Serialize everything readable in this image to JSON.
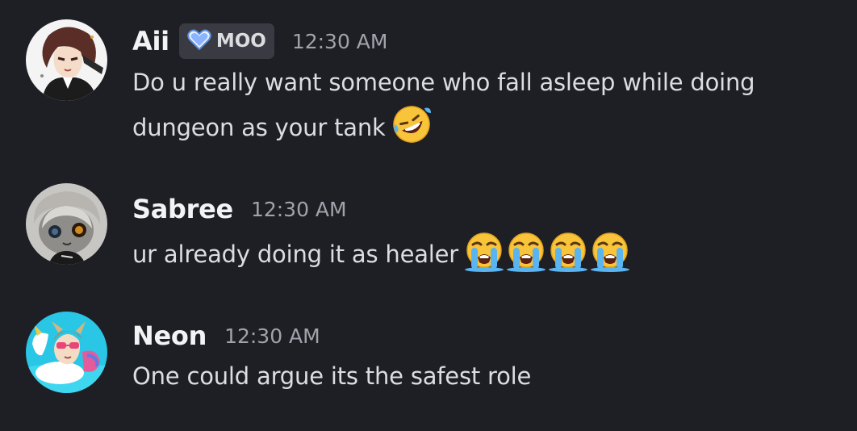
{
  "messages": [
    {
      "username": "Aii",
      "tag": {
        "icon": "heart-icon",
        "label": "MOO"
      },
      "timestamp": "12:30 AM",
      "lines": [
        "Do u really want someone who fall asleep while doing",
        "dungeon as your tank"
      ],
      "emojis": [
        "rolling-on-floor-laughing-emoji"
      ]
    },
    {
      "username": "Sabree",
      "timestamp": "12:30 AM",
      "lines": [
        "ur already doing it as healer"
      ],
      "emojis": [
        "loudly-crying-emoji",
        "loudly-crying-emoji",
        "loudly-crying-emoji",
        "loudly-crying-emoji"
      ]
    },
    {
      "username": "Neon",
      "timestamp": "12:30 AM",
      "lines": [
        "One could argue its the safest role"
      ],
      "emojis": []
    }
  ],
  "colors": {
    "background": "#1e1f25",
    "username": "#f2f3f5",
    "text": "#dbdee1",
    "timestamp": "#a0a3ab",
    "tag_background": "#3a3b42",
    "tag_heart": "#8ab4ff"
  }
}
